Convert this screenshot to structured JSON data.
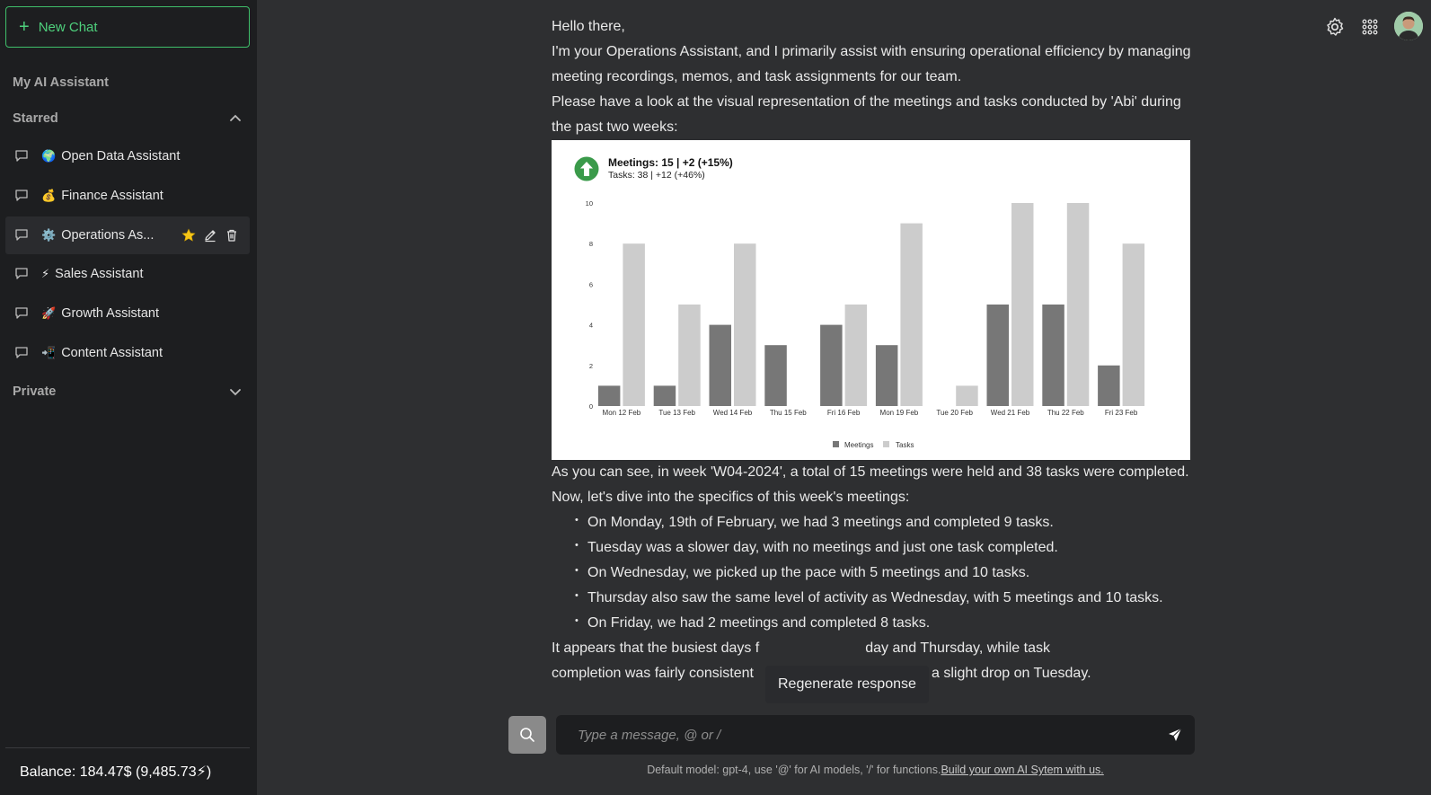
{
  "sidebar": {
    "new_chat_label": "New Chat",
    "my_assistant_title": "My AI Assistant",
    "starred_title": "Starred",
    "private_title": "Private",
    "items": [
      {
        "emoji": "🌍",
        "label": "Open Data Assistant"
      },
      {
        "emoji": "💰",
        "label": "Finance Assistant"
      },
      {
        "emoji": "⚙️",
        "label": "Operations As..."
      },
      {
        "emoji": "⚡",
        "label": "Sales Assistant"
      },
      {
        "emoji": "🚀",
        "label": "Growth Assistant"
      },
      {
        "emoji": "📲",
        "label": "Content Assistant"
      }
    ],
    "balance": "Balance: 184.47$ (9,485.73⚡)"
  },
  "message": {
    "greeting": "Hello there,",
    "intro": "I'm your Operations Assistant, and I primarily assist with ensuring operational efficiency by managing meeting recordings, memos, and task assignments for our team.",
    "visual_intro": "Please have a look at the visual representation of the meetings and tasks conducted by 'Abi' during the past two weeks:",
    "summary": "As you can see, in week 'W04-2024', a total of 15 meetings were held and 38 tasks were completed.",
    "dive": "Now, let's dive into the specifics of this week's meetings:",
    "bullets": [
      "On Monday, 19th of February, we had 3 meetings and completed 9 tasks.",
      "Tuesday was a slower day, with no meetings and just one task completed.",
      "On Wednesday, we picked up the pace with 5 meetings and 10 tasks.",
      "Thursday also saw the same level of activity as Wednesday, with 5 meetings and 10 tasks.",
      "On Friday, we had 2 meetings and completed 8 tasks."
    ],
    "closing": "It appears that the busiest days f░ ░ ░ ░ ░ ░ day and Thursday, while task completion was fairly consistent ░ ░ ░ ░ ░ ░ a slight drop on Tuesday.",
    "closing_a": "It appears that the busiest days f",
    "closing_b": "day and Thursday, while task",
    "closing_c": "completion was fairly consistent",
    "closing_d": "a slight drop on Tuesday."
  },
  "chart_data": {
    "type": "bar",
    "title": "Meetings: 15 | +2 (+15%)",
    "subtitle": "Tasks: 38 | +12 (+46%)",
    "categories": [
      "Mon 12 Feb",
      "Tue 13 Feb",
      "Wed 14 Feb",
      "Thu 15 Feb",
      "Fri 16 Feb",
      "Mon 19 Feb",
      "Tue 20 Feb",
      "Wed 21 Feb",
      "Thu 22 Feb",
      "Fri 23 Feb"
    ],
    "series": [
      {
        "name": "Meetings",
        "color": "#777777",
        "values": [
          1,
          1,
          4,
          3,
          4,
          3,
          0,
          5,
          5,
          2
        ]
      },
      {
        "name": "Tasks",
        "color": "#cccccc",
        "values": [
          8,
          5,
          8,
          0,
          5,
          9,
          1,
          10,
          10,
          8
        ]
      }
    ],
    "ylim": [
      0,
      10
    ],
    "yticks": [
      "0",
      "2",
      "4",
      "6",
      "8",
      "10"
    ],
    "legend_position": "bottom-center",
    "trend_icon_color": "#3a9a4a"
  },
  "regenerate_label": "Regenerate response",
  "input": {
    "placeholder": "Type a message, @ or /"
  },
  "footer": {
    "text": "Default model: gpt-4, use '@' for AI models, '/' for functions.",
    "link": "Build your own AI Sytem with us."
  },
  "colors": {
    "accent": "#4ed07c",
    "background": "#2e2f31",
    "sidebar": "#1d1e20"
  }
}
